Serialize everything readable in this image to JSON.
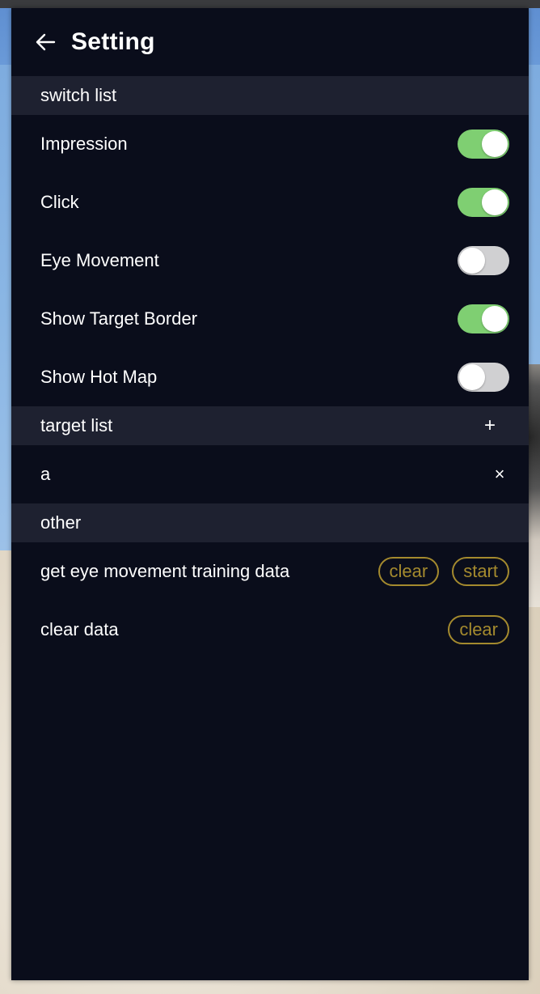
{
  "header": {
    "back_icon": "arrow-left-icon",
    "title": "Setting"
  },
  "sections": {
    "switch_list": {
      "label": "switch list",
      "items": [
        {
          "label": "Impression",
          "on": true
        },
        {
          "label": "Click",
          "on": true
        },
        {
          "label": "Eye Movement",
          "on": false
        },
        {
          "label": "Show Target Border",
          "on": true
        },
        {
          "label": "Show Hot Map",
          "on": false
        }
      ]
    },
    "target_list": {
      "label": "target list",
      "add_label": "+",
      "items": [
        {
          "label": "a",
          "remove_label": "×"
        }
      ]
    },
    "other": {
      "label": "other",
      "items": [
        {
          "label": "get eye movement training data",
          "clear_label": "clear",
          "start_label": "start"
        },
        {
          "label": "clear data",
          "clear_label": "clear"
        }
      ]
    }
  },
  "colors": {
    "panel_bg": "#0a0d1b",
    "section_bg": "#1e2130",
    "toggle_on": "#7fcf72",
    "toggle_off": "#d0d0d2",
    "pill_accent": "#a48a2e"
  }
}
